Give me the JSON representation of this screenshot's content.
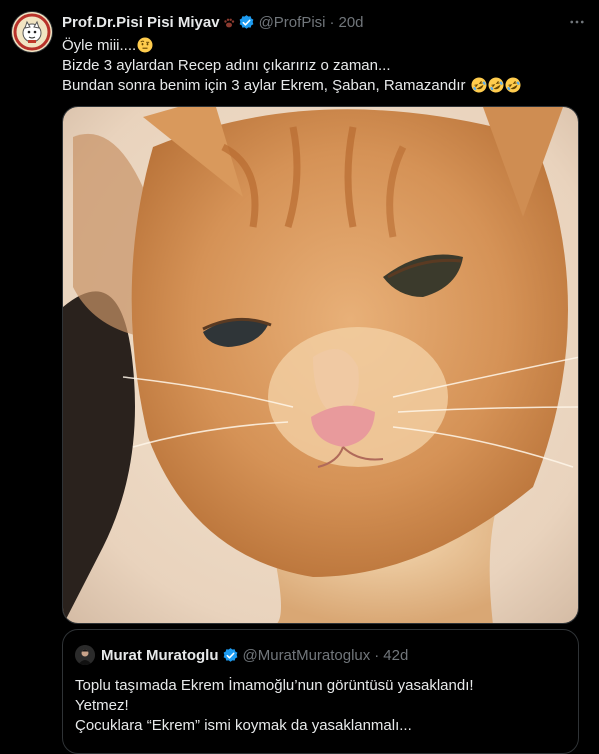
{
  "tweet": {
    "author_name": "Prof.Dr.Pisi Pisi Miyav",
    "handle": "@ProfPisi",
    "separator": "·",
    "time": "20d",
    "lines": [
      "Öyle miii....",
      "Bizde 3 aylardan Recep adını çıkarırız o zaman...",
      "Bundan sonra benim için 3 aylar Ekrem, Şaban, Ramazandır"
    ],
    "emojis": [
      "face-with-raised-eyebrow",
      "rolling-on-floor-laughing",
      "rolling-on-floor-laughing",
      "rolling-on-floor-laughing"
    ]
  },
  "quote": {
    "author_name": "Murat Muratoglu",
    "handle": "@MuratMuratoglux",
    "separator": "·",
    "time": "42d",
    "lines": [
      "Toplu taşımada Ekrem İmamoğlu’nun görüntüsü yasaklandı!",
      "Yetmez!",
      "Çocuklara “Ekrem” ismi koymak da yasaklanmalı..."
    ]
  },
  "colors": {
    "background": "#000000",
    "text_primary": "#e7e9ea",
    "text_secondary": "#71767b",
    "verified": "#1d9bf0",
    "border": "#2f3336"
  }
}
